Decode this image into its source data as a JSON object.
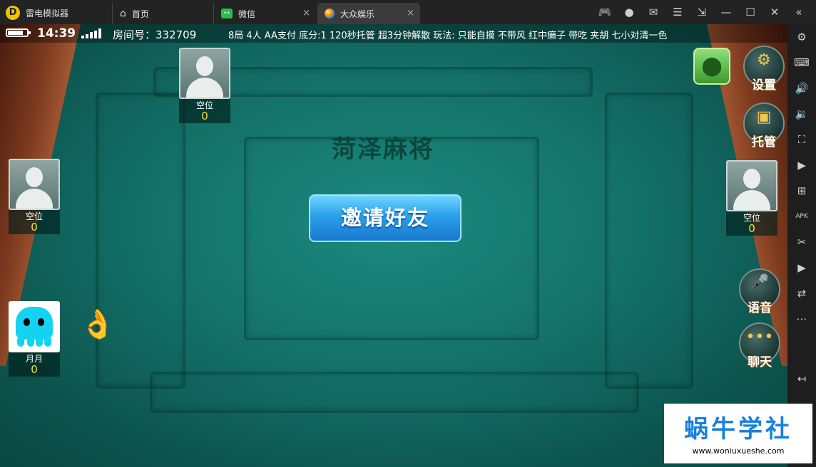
{
  "window": {
    "app_name": "雷电模拟器",
    "tabs": [
      {
        "label": "首页"
      },
      {
        "label": "微信"
      },
      {
        "label": "大众娱乐"
      }
    ],
    "close_glyph": "×"
  },
  "status": {
    "time": "14:39",
    "battery_fraction": 0.8,
    "signal_bars": 5,
    "room_text": "房间号：332709",
    "rules_text": "8局 4人 AA支付 底分:1 120秒托管 超3分钟解散  玩法:  只能自摸 不带风 红中癞子 带吃 夹胡 七小对清一色"
  },
  "table": {
    "logo": "菏泽麻将",
    "invite_button": "邀请好友"
  },
  "seats": [
    {
      "name": "空位",
      "score": "0"
    },
    {
      "name": "空位",
      "score": "0"
    },
    {
      "name": "空位",
      "score": "0"
    },
    {
      "name": "月月",
      "score": "0"
    }
  ],
  "buttons": {
    "settings": "设置",
    "auto_play": "托管",
    "voice": "语音",
    "chat": "聊天"
  },
  "watermark": {
    "title": "蜗牛学社",
    "url": "www.woniuxueshe.com"
  },
  "colors": {
    "felt": "#137067",
    "invite_blue": "#2aa0ea",
    "score_yellow": "#f4e43a",
    "watermark_blue": "#1a7fe0"
  },
  "icons": {
    "sidebar": [
      "gear-icon",
      "keyboard-icon",
      "volume-up-icon",
      "volume-down-icon",
      "fullscreen-icon",
      "record-icon",
      "add-window-icon",
      "apk-icon",
      "scissors-icon",
      "video-icon",
      "sync-icon",
      "more-icon",
      "back-icon"
    ]
  }
}
